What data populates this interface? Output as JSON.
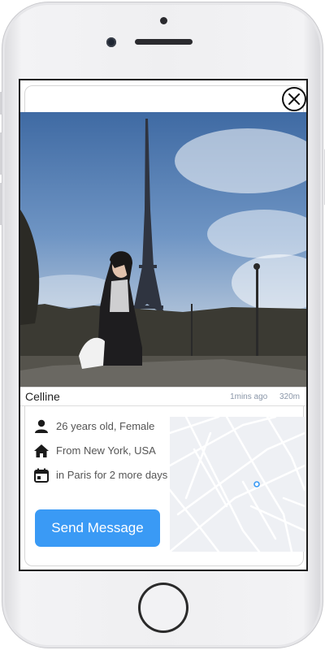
{
  "profile": {
    "name": "Celline",
    "time_ago": "1mins ago",
    "distance": "320m"
  },
  "details": [
    {
      "icon": "person-icon",
      "text": "26 years old, Female"
    },
    {
      "icon": "home-icon",
      "text": "From New York, USA"
    },
    {
      "icon": "calendar-icon",
      "text": "in Paris for 2 more days"
    }
  ],
  "actions": {
    "send_label": "Send Message",
    "close_icon": "close-icon"
  },
  "colors": {
    "accent": "#3a9af5",
    "map_marker": "#3a9af5"
  }
}
